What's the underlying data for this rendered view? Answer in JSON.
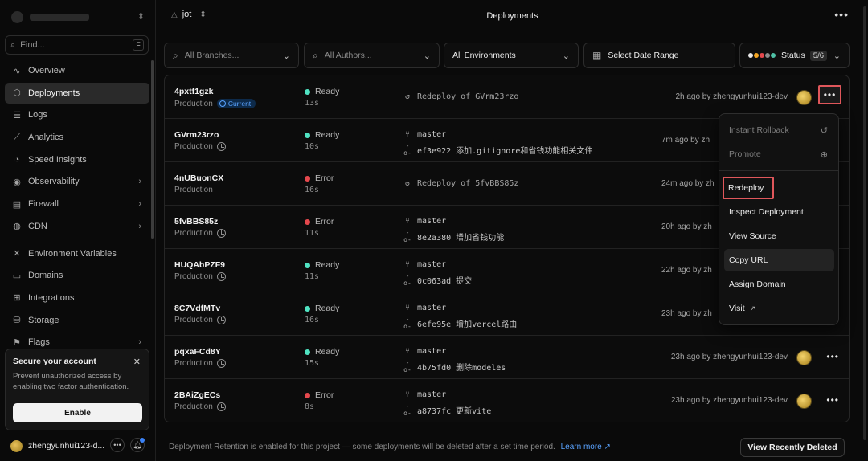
{
  "sidebar": {
    "find_placeholder": "Find...",
    "find_shortcut": "F",
    "items": [
      {
        "label": "Overview",
        "icon": "pulse-icon"
      },
      {
        "label": "Deployments",
        "icon": "cube-icon",
        "active": true
      },
      {
        "label": "Logs",
        "icon": "list-icon"
      },
      {
        "label": "Analytics",
        "icon": "chart-icon"
      },
      {
        "label": "Speed Insights",
        "icon": "gauge-icon"
      },
      {
        "label": "Observability",
        "icon": "eye-icon",
        "arrow": true
      },
      {
        "label": "Firewall",
        "icon": "firewall-icon",
        "arrow": true
      },
      {
        "label": "CDN",
        "icon": "globe-icon",
        "arrow": true
      },
      {
        "label": "Environment Variables",
        "icon": "variables-icon"
      },
      {
        "label": "Domains",
        "icon": "domain-icon"
      },
      {
        "label": "Integrations",
        "icon": "integrations-icon"
      },
      {
        "label": "Storage",
        "icon": "database-icon"
      },
      {
        "label": "Flags",
        "icon": "flag-icon",
        "arrow": true
      }
    ],
    "secure": {
      "title": "Secure your account",
      "desc": "Prevent unauthorized access by enabling two factor authentication.",
      "button": "Enable"
    },
    "user": "zhengyunhui123-d..."
  },
  "header": {
    "project": "jot",
    "title": "Deployments"
  },
  "filters": {
    "branches": "All Branches...",
    "authors": "All Authors...",
    "environments": "All Environments",
    "date": "Select Date Range",
    "status": "Status",
    "status_count": "5/6",
    "status_colors": [
      "#e9e9e9",
      "#f5a623",
      "#e5484d",
      "#8c8c8c",
      "#4fc1a6"
    ]
  },
  "colors": {
    "ready": "#50e3c2",
    "error": "#e5484d",
    "link": "#5aa3ff"
  },
  "deployments": [
    {
      "id": "4pxtf1gzk",
      "env": "Production",
      "current": "Current",
      "status": "Ready",
      "status_color": "#50e3c2",
      "duration": "13s",
      "redeploy": "Redeploy of GVrm23rzo",
      "when": "2h ago by zhengyunhui123-dev"
    },
    {
      "id": "GVrm23rzo",
      "env": "Production",
      "status": "Ready",
      "status_color": "#50e3c2",
      "duration": "10s",
      "branch": "master",
      "commit": "ef3e922 添加.gitignore和省钱功能相关文件",
      "when": "7m ago by zh"
    },
    {
      "id": "4nUBuonCX",
      "env": "Production",
      "status": "Error",
      "status_color": "#e5484d",
      "duration": "16s",
      "redeploy": "Redeploy of 5fvBBS85z",
      "when": "24m ago by zh"
    },
    {
      "id": "5fvBBS85z",
      "env": "Production",
      "status": "Error",
      "status_color": "#e5484d",
      "duration": "11s",
      "branch": "master",
      "commit": "8e2a380 增加省钱功能",
      "when": "20h ago by zh"
    },
    {
      "id": "HUQAbPZF9",
      "env": "Production",
      "status": "Ready",
      "status_color": "#50e3c2",
      "duration": "11s",
      "branch": "master",
      "commit": "0c063ad 提交",
      "when": "22h ago by zh"
    },
    {
      "id": "8C7VdfMTv",
      "env": "Production",
      "status": "Ready",
      "status_color": "#50e3c2",
      "duration": "16s",
      "branch": "master",
      "commit": "6efe95e 增加vercel路由",
      "when": "23h ago by zh"
    },
    {
      "id": "pqxaFCd8Y",
      "env": "Production",
      "status": "Ready",
      "status_color": "#50e3c2",
      "duration": "15s",
      "branch": "master",
      "commit": "4b75fd0 删除modeles",
      "when": "23h ago by zhengyunhui123-dev"
    },
    {
      "id": "2BAiZgECs",
      "env": "Production",
      "status": "Error",
      "status_color": "#e5484d",
      "duration": "8s",
      "branch": "master",
      "commit": "a8737fc 更新vite",
      "when": "23h ago by zhengyunhui123-dev"
    }
  ],
  "menu": {
    "instant_rollback": "Instant Rollback",
    "promote": "Promote",
    "redeploy": "Redeploy",
    "inspect": "Inspect Deployment",
    "view_source": "View Source",
    "copy_url": "Copy URL",
    "assign_domain": "Assign Domain",
    "visit": "Visit"
  },
  "footer": {
    "note": "Deployment Retention is enabled for this project — some deployments will be deleted after a set time period.",
    "learn_more": "Learn more",
    "view_deleted": "View Recently Deleted"
  }
}
